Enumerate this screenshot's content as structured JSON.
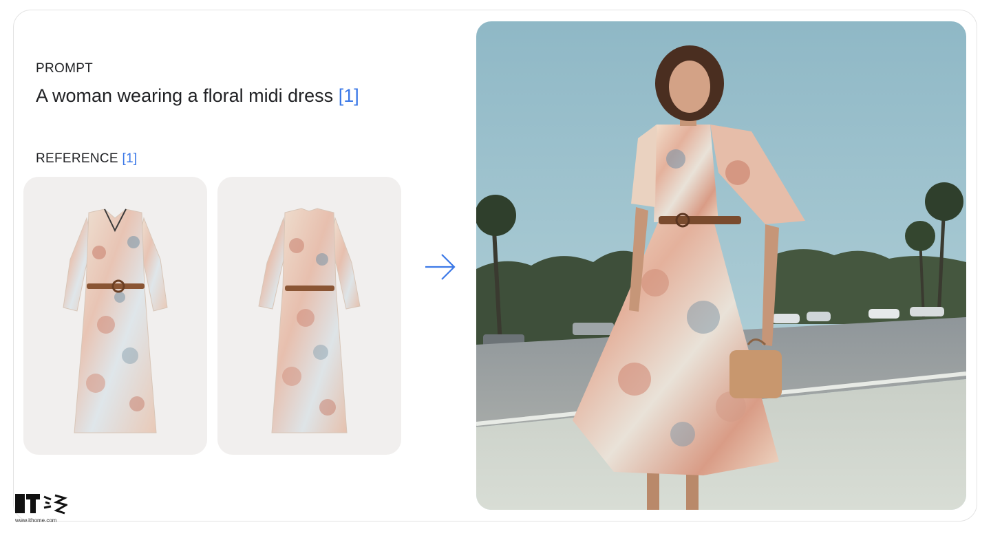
{
  "prompt": {
    "heading": "PROMPT",
    "text": "A woman wearing a floral midi dress",
    "ref": "[1]"
  },
  "reference": {
    "heading": "REFERENCE",
    "ref": "[1]",
    "images": [
      {
        "icon": "dress-front-image"
      },
      {
        "icon": "dress-back-image"
      }
    ]
  },
  "arrow": {
    "icon": "right-arrow-icon",
    "color": "#3b78e7"
  },
  "output": {
    "icon": "generated-photo-woman-floral-dress"
  },
  "watermark": {
    "logo": "IT之家",
    "url": "www.ithome.com"
  },
  "colors": {
    "accent": "#3b78e7",
    "tile_bg": "#f1efee",
    "sky": "#a9ccd6"
  }
}
